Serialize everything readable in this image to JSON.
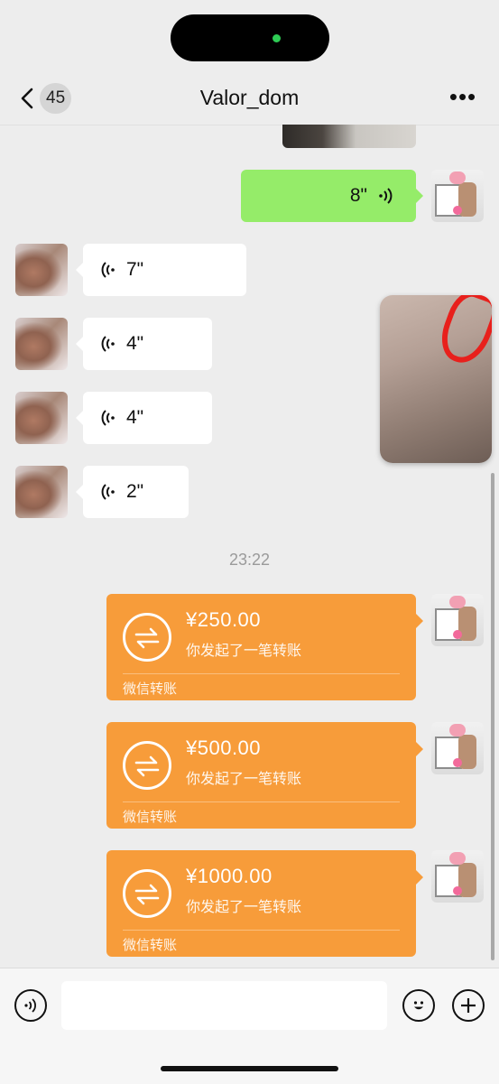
{
  "header": {
    "back_badge": "45",
    "title": "Valor_dom",
    "more_label": "•••"
  },
  "messages": {
    "outgoing_voice": {
      "duration": "8\""
    },
    "incoming_voice": [
      {
        "duration": "7\""
      },
      {
        "duration": "4\""
      },
      {
        "duration": "4\""
      },
      {
        "duration": "2\""
      }
    ],
    "timestamp": "23:22",
    "transfers": [
      {
        "amount": "¥250.00",
        "description": "你发起了一笔转账",
        "footer": "微信转账"
      },
      {
        "amount": "¥500.00",
        "description": "你发起了一笔转账",
        "footer": "微信转账"
      },
      {
        "amount": "¥1000.00",
        "description": "你发起了一笔转账",
        "footer": "微信转账"
      }
    ]
  },
  "input_bar": {
    "text_value": "",
    "icons": [
      "voice-mode-icon",
      "emoji-icon",
      "plus-icon"
    ]
  },
  "colors": {
    "background": "#ededed",
    "outgoing_bubble": "#95ec69",
    "incoming_bubble": "#ffffff",
    "transfer_card": "#f79c3a"
  }
}
